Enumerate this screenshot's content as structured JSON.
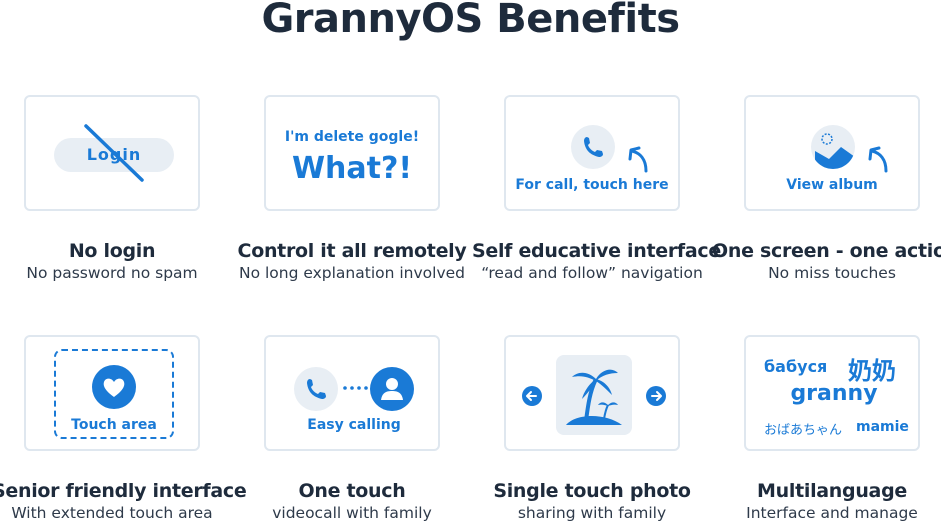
{
  "title": "GrannyOS Benefits",
  "colors": {
    "accent": "#1a7ad6",
    "light": "#e8eef4",
    "border": "#dfe7ef",
    "text": "#1e2b3c"
  },
  "cards": [
    {
      "title": "No login",
      "subtitle": "No password no spam",
      "inner_label": "Login",
      "icon": "crossed-login-pill"
    },
    {
      "title": "Control it all remotely",
      "subtitle": "No long explanation involved",
      "inner_top": "I'm delete gogle!",
      "inner_big": "What?!"
    },
    {
      "title": "Self educative interface",
      "subtitle": "“read and follow” navigation",
      "inner_label": "For call, touch here",
      "icon": "phone-icon"
    },
    {
      "title": "One screen - one action",
      "subtitle": "No miss touches",
      "inner_label": "View album",
      "icon": "album-icon"
    },
    {
      "title": "Senior friendly interface",
      "subtitle": "With extended touch area",
      "inner_label": "Touch area",
      "icon": "heart-icon"
    },
    {
      "title": "One touch",
      "subtitle": "videocall with family",
      "inner_label": "Easy calling",
      "icon": "phone-to-contact"
    },
    {
      "title": "Single touch photo",
      "subtitle": "sharing with family",
      "icon": "island-photo"
    },
    {
      "title": "Multilanguage",
      "subtitle": "Interface and manage",
      "lang": {
        "ru": "бабуся",
        "zh": "奶奶",
        "en": "granny",
        "ja": "おばあちゃん",
        "fr": "mamie"
      }
    }
  ]
}
